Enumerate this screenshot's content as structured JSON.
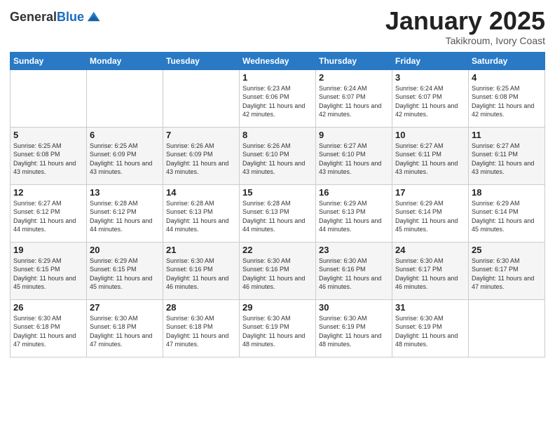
{
  "logo": {
    "general": "General",
    "blue": "Blue"
  },
  "header": {
    "title": "January 2025",
    "location": "Takikroum, Ivory Coast"
  },
  "weekdays": [
    "Sunday",
    "Monday",
    "Tuesday",
    "Wednesday",
    "Thursday",
    "Friday",
    "Saturday"
  ],
  "weeks": [
    [
      {
        "day": "",
        "sunrise": "",
        "sunset": "",
        "daylight": ""
      },
      {
        "day": "",
        "sunrise": "",
        "sunset": "",
        "daylight": ""
      },
      {
        "day": "",
        "sunrise": "",
        "sunset": "",
        "daylight": ""
      },
      {
        "day": "1",
        "sunrise": "Sunrise: 6:23 AM",
        "sunset": "Sunset: 6:06 PM",
        "daylight": "Daylight: 11 hours and 42 minutes."
      },
      {
        "day": "2",
        "sunrise": "Sunrise: 6:24 AM",
        "sunset": "Sunset: 6:07 PM",
        "daylight": "Daylight: 11 hours and 42 minutes."
      },
      {
        "day": "3",
        "sunrise": "Sunrise: 6:24 AM",
        "sunset": "Sunset: 6:07 PM",
        "daylight": "Daylight: 11 hours and 42 minutes."
      },
      {
        "day": "4",
        "sunrise": "Sunrise: 6:25 AM",
        "sunset": "Sunset: 6:08 PM",
        "daylight": "Daylight: 11 hours and 42 minutes."
      }
    ],
    [
      {
        "day": "5",
        "sunrise": "Sunrise: 6:25 AM",
        "sunset": "Sunset: 6:08 PM",
        "daylight": "Daylight: 11 hours and 43 minutes."
      },
      {
        "day": "6",
        "sunrise": "Sunrise: 6:25 AM",
        "sunset": "Sunset: 6:09 PM",
        "daylight": "Daylight: 11 hours and 43 minutes."
      },
      {
        "day": "7",
        "sunrise": "Sunrise: 6:26 AM",
        "sunset": "Sunset: 6:09 PM",
        "daylight": "Daylight: 11 hours and 43 minutes."
      },
      {
        "day": "8",
        "sunrise": "Sunrise: 6:26 AM",
        "sunset": "Sunset: 6:10 PM",
        "daylight": "Daylight: 11 hours and 43 minutes."
      },
      {
        "day": "9",
        "sunrise": "Sunrise: 6:27 AM",
        "sunset": "Sunset: 6:10 PM",
        "daylight": "Daylight: 11 hours and 43 minutes."
      },
      {
        "day": "10",
        "sunrise": "Sunrise: 6:27 AM",
        "sunset": "Sunset: 6:11 PM",
        "daylight": "Daylight: 11 hours and 43 minutes."
      },
      {
        "day": "11",
        "sunrise": "Sunrise: 6:27 AM",
        "sunset": "Sunset: 6:11 PM",
        "daylight": "Daylight: 11 hours and 43 minutes."
      }
    ],
    [
      {
        "day": "12",
        "sunrise": "Sunrise: 6:27 AM",
        "sunset": "Sunset: 6:12 PM",
        "daylight": "Daylight: 11 hours and 44 minutes."
      },
      {
        "day": "13",
        "sunrise": "Sunrise: 6:28 AM",
        "sunset": "Sunset: 6:12 PM",
        "daylight": "Daylight: 11 hours and 44 minutes."
      },
      {
        "day": "14",
        "sunrise": "Sunrise: 6:28 AM",
        "sunset": "Sunset: 6:13 PM",
        "daylight": "Daylight: 11 hours and 44 minutes."
      },
      {
        "day": "15",
        "sunrise": "Sunrise: 6:28 AM",
        "sunset": "Sunset: 6:13 PM",
        "daylight": "Daylight: 11 hours and 44 minutes."
      },
      {
        "day": "16",
        "sunrise": "Sunrise: 6:29 AM",
        "sunset": "Sunset: 6:13 PM",
        "daylight": "Daylight: 11 hours and 44 minutes."
      },
      {
        "day": "17",
        "sunrise": "Sunrise: 6:29 AM",
        "sunset": "Sunset: 6:14 PM",
        "daylight": "Daylight: 11 hours and 45 minutes."
      },
      {
        "day": "18",
        "sunrise": "Sunrise: 6:29 AM",
        "sunset": "Sunset: 6:14 PM",
        "daylight": "Daylight: 11 hours and 45 minutes."
      }
    ],
    [
      {
        "day": "19",
        "sunrise": "Sunrise: 6:29 AM",
        "sunset": "Sunset: 6:15 PM",
        "daylight": "Daylight: 11 hours and 45 minutes."
      },
      {
        "day": "20",
        "sunrise": "Sunrise: 6:29 AM",
        "sunset": "Sunset: 6:15 PM",
        "daylight": "Daylight: 11 hours and 45 minutes."
      },
      {
        "day": "21",
        "sunrise": "Sunrise: 6:30 AM",
        "sunset": "Sunset: 6:16 PM",
        "daylight": "Daylight: 11 hours and 46 minutes."
      },
      {
        "day": "22",
        "sunrise": "Sunrise: 6:30 AM",
        "sunset": "Sunset: 6:16 PM",
        "daylight": "Daylight: 11 hours and 46 minutes."
      },
      {
        "day": "23",
        "sunrise": "Sunrise: 6:30 AM",
        "sunset": "Sunset: 6:16 PM",
        "daylight": "Daylight: 11 hours and 46 minutes."
      },
      {
        "day": "24",
        "sunrise": "Sunrise: 6:30 AM",
        "sunset": "Sunset: 6:17 PM",
        "daylight": "Daylight: 11 hours and 46 minutes."
      },
      {
        "day": "25",
        "sunrise": "Sunrise: 6:30 AM",
        "sunset": "Sunset: 6:17 PM",
        "daylight": "Daylight: 11 hours and 47 minutes."
      }
    ],
    [
      {
        "day": "26",
        "sunrise": "Sunrise: 6:30 AM",
        "sunset": "Sunset: 6:18 PM",
        "daylight": "Daylight: 11 hours and 47 minutes."
      },
      {
        "day": "27",
        "sunrise": "Sunrise: 6:30 AM",
        "sunset": "Sunset: 6:18 PM",
        "daylight": "Daylight: 11 hours and 47 minutes."
      },
      {
        "day": "28",
        "sunrise": "Sunrise: 6:30 AM",
        "sunset": "Sunset: 6:18 PM",
        "daylight": "Daylight: 11 hours and 47 minutes."
      },
      {
        "day": "29",
        "sunrise": "Sunrise: 6:30 AM",
        "sunset": "Sunset: 6:19 PM",
        "daylight": "Daylight: 11 hours and 48 minutes."
      },
      {
        "day": "30",
        "sunrise": "Sunrise: 6:30 AM",
        "sunset": "Sunset: 6:19 PM",
        "daylight": "Daylight: 11 hours and 48 minutes."
      },
      {
        "day": "31",
        "sunrise": "Sunrise: 6:30 AM",
        "sunset": "Sunset: 6:19 PM",
        "daylight": "Daylight: 11 hours and 48 minutes."
      },
      {
        "day": "",
        "sunrise": "",
        "sunset": "",
        "daylight": ""
      }
    ]
  ]
}
